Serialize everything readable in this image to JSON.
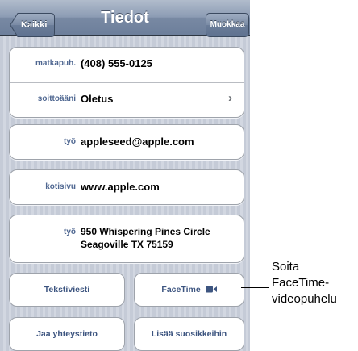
{
  "navbar": {
    "title": "Tiedot",
    "back_label": "Kaikki",
    "edit_label": "Muokkaa"
  },
  "contact": {
    "phone": {
      "label": "matkapuh.",
      "value": "(408) 555-0125"
    },
    "ringtone": {
      "label": "soittoääni",
      "value": "Oletus"
    },
    "email": {
      "label": "työ",
      "value": "appleseed@apple.com"
    },
    "homepage": {
      "label": "kotisivu",
      "value": "www.apple.com"
    },
    "address": {
      "label": "työ",
      "line1": "950 Whispering Pines Circle",
      "line2": "Seagoville TX 75159"
    }
  },
  "actions": {
    "text_message": "Tekstiviesti",
    "facetime": "FaceTime",
    "share_contact": "Jaa yhteystieto",
    "add_favorite": "Lisää suosikkeihin"
  },
  "annotation": {
    "line1": "Soita",
    "line2": "FaceTime-",
    "line3": "videopuhelu"
  },
  "icons": {
    "chevron": "chevron-right-icon",
    "video": "video-camera-icon"
  }
}
